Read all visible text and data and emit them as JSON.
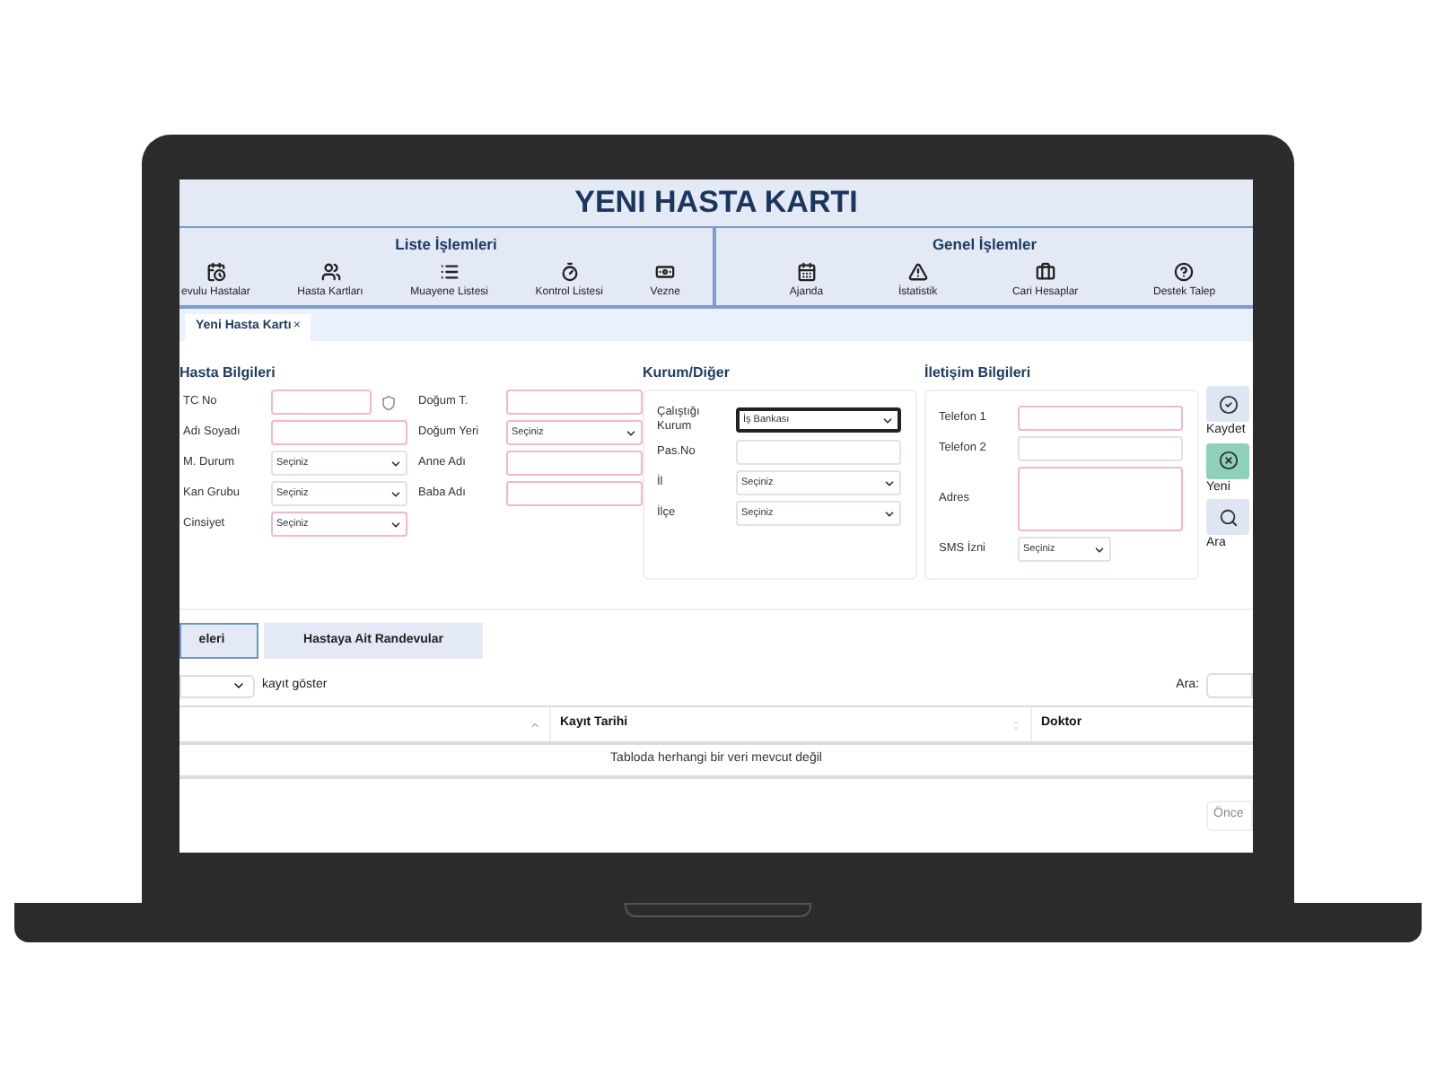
{
  "window": {
    "title": "YENI HASTA KARTI"
  },
  "toolbar": {
    "groups": [
      {
        "title": "Liste İşlemleri",
        "items": [
          {
            "label": "evulu Hastalar"
          },
          {
            "label": "Hasta Kartları"
          },
          {
            "label": "Muayene Listesi"
          },
          {
            "label": "Kontrol Listesi"
          },
          {
            "label": "Vezne"
          }
        ]
      },
      {
        "title": "Genel İşlemler",
        "items": [
          {
            "label": "Ajanda"
          },
          {
            "label": "İstatistik"
          },
          {
            "label": "Cari Hesaplar"
          },
          {
            "label": "Destek Talep"
          }
        ]
      }
    ]
  },
  "tabs": [
    {
      "label": "Yeni Hasta Kartı",
      "close": "×",
      "selected": true
    }
  ],
  "sections": [
    {
      "title": "Hasta Bilgileri",
      "fields": [
        {
          "label": "TC No",
          "kind": "id",
          "required": true
        },
        {
          "label": "Doğum T.",
          "kind": "text",
          "required": true
        },
        {
          "label": "Adı Soyadı",
          "kind": "text",
          "required": true
        },
        {
          "label": "Doğum Yeri",
          "kind": "select",
          "value": "Seçiniz",
          "required": true
        },
        {
          "label": "M. Durum",
          "kind": "select",
          "value": "Seçiniz",
          "required": false
        },
        {
          "label": "Anne Adı",
          "kind": "text",
          "required": true
        },
        {
          "label": "Kan Grubu",
          "kind": "select",
          "value": "Seçiniz",
          "required": false
        },
        {
          "label": "Baba Adı",
          "kind": "text",
          "required": true
        },
        {
          "label": "Cinsiyet",
          "kind": "select",
          "value": "Seçiniz",
          "required": true
        }
      ]
    },
    {
      "title": "Kurum/Diğer",
      "fields": [
        {
          "label": "Çalıştığı Kurum",
          "kind": "select",
          "value": "İş Bankası",
          "required": false,
          "focused": true
        },
        {
          "label": "Pas.No",
          "kind": "text",
          "required": false
        },
        {
          "label": "İl",
          "kind": "select",
          "value": "Seçiniz",
          "required": false
        },
        {
          "label": "İlçe",
          "kind": "select",
          "value": "Seçiniz",
          "required": false
        }
      ]
    },
    {
      "title": "İletişim Bilgileri",
      "fields": [
        {
          "label": "Telefon 1",
          "kind": "text",
          "required": true
        },
        {
          "label": "Telefon 2",
          "kind": "text",
          "required": false
        },
        {
          "label": "Adres",
          "kind": "textarea",
          "required": true
        },
        {
          "label": "SMS İzni",
          "kind": "small-select",
          "value": "Seçiniz",
          "required": false
        }
      ]
    }
  ],
  "actions": [
    {
      "label": "Kaydet",
      "kind": "save"
    },
    {
      "label": "Yeni",
      "kind": "new"
    },
    {
      "label": "Ara",
      "kind": "search"
    }
  ],
  "subtabs": [
    {
      "label": "eleri",
      "selected": true
    },
    {
      "label": "Hastaya Ait Randevular",
      "selected": false
    }
  ],
  "table": {
    "length_label": "kayıt göster",
    "search_label": "Ara:",
    "columns": [
      {
        "sorted": true
      },
      {
        "label": "Kayıt Tarihi",
        "sorted": false
      },
      {
        "label": "Doktor"
      }
    ],
    "empty_message": "Tabloda herhangi bir veri mevcut değil",
    "prev": "Önce"
  }
}
